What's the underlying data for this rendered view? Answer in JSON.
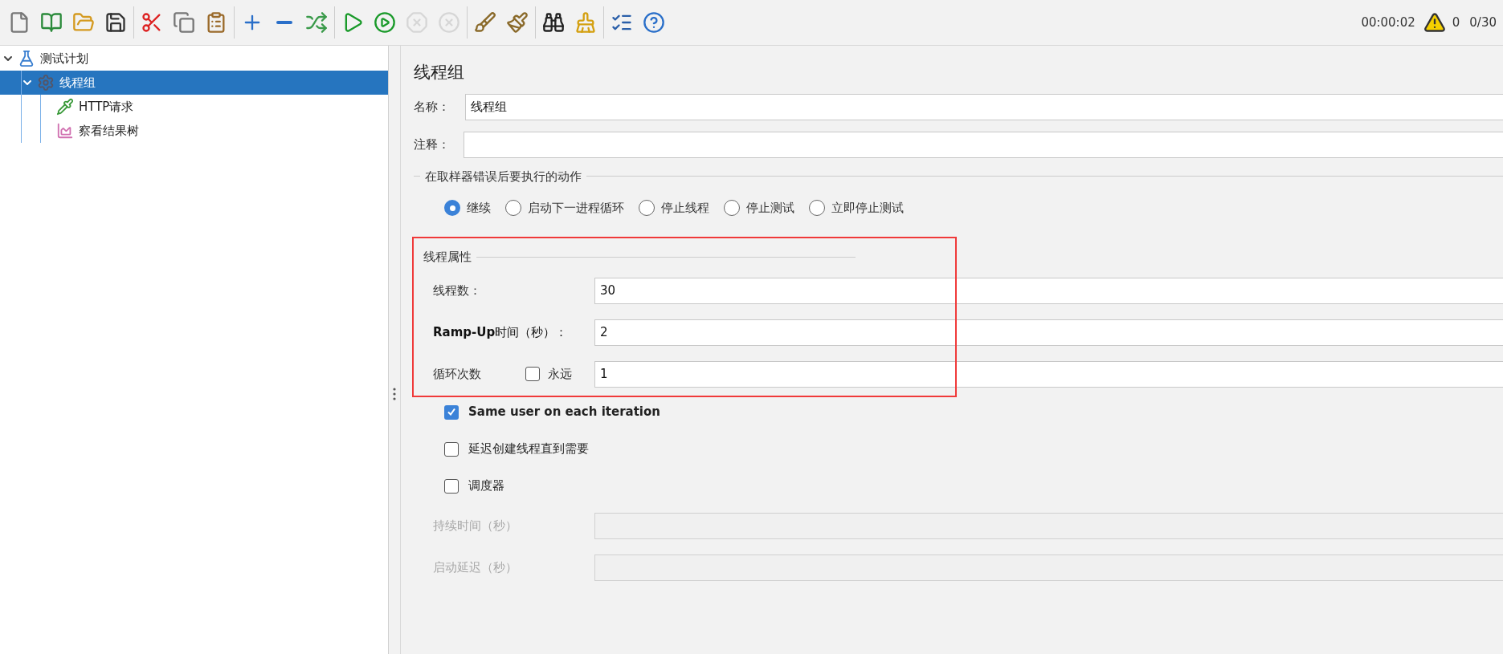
{
  "toolbar": {
    "groups": [
      [
        {
          "disabled": false
        },
        {
          "disabled": false
        },
        {
          "disabled": false
        },
        {
          "disabled": false
        }
      ],
      [
        {
          "disabled": false
        },
        {
          "disabled": false
        },
        {
          "disabled": false
        }
      ],
      [
        {
          "disabled": false
        },
        {
          "disabled": false
        },
        {
          "disabled": false
        }
      ],
      [
        {
          "disabled": false
        },
        {
          "disabled": false
        },
        {
          "disabled": true
        },
        {
          "disabled": true
        }
      ],
      [
        {
          "disabled": false
        },
        {
          "disabled": false
        }
      ],
      [
        {
          "disabled": false
        },
        {
          "disabled": false
        }
      ],
      [
        {
          "disabled": false
        },
        {
          "disabled": false
        }
      ]
    ],
    "timer": "00:00:02",
    "warnings": "0",
    "threads": "0/30"
  },
  "tree": [
    {
      "kind": "plan",
      "label": "测试计划",
      "expanded": true,
      "selected": false,
      "children": [
        {
          "kind": "thread_group",
          "label": "线程组",
          "expanded": true,
          "selected": true,
          "children": [
            {
              "kind": "sampler",
              "label": "HTTP请求",
              "selected": false
            },
            {
              "kind": "listener",
              "label": "察看结果树",
              "selected": false
            }
          ]
        }
      ]
    }
  ],
  "panel": {
    "title": "线程组",
    "name": {
      "label": "名称：",
      "value": "线程组"
    },
    "comment": {
      "label": "注释："
    },
    "error_action": {
      "legend": "在取样器错误后要执行的动作",
      "options": [
        {
          "label": "继续",
          "selected": true
        },
        {
          "label": "启动下一进程循环",
          "selected": false
        },
        {
          "label": "停止线程",
          "selected": false
        },
        {
          "label": "停止测试",
          "selected": false
        },
        {
          "label": "立即停止测试",
          "selected": false
        }
      ]
    },
    "thread_properties": {
      "legend": "线程属性",
      "highlighted": true,
      "threads": {
        "label": "线程数：",
        "value": "30"
      },
      "ramp_up": {
        "label": "**Ramp-Up**时间（秒）：",
        "value": "2"
      },
      "loop": {
        "label": "循环次数",
        "forever": {
          "label": "永远",
          "checked": false
        },
        "value": "1"
      }
    },
    "options": [
      {
        "label": "Same user on each iteration",
        "checked": true
      },
      {
        "label": "延迟创建线程直到需要",
        "checked": false
      },
      {
        "label": "调度器",
        "checked": false
      }
    ],
    "scheduler_fields": [
      {
        "label": "持续时间（秒）",
        "disabled": true
      },
      {
        "label": "启动延迟（秒）",
        "disabled": true
      }
    ]
  }
}
